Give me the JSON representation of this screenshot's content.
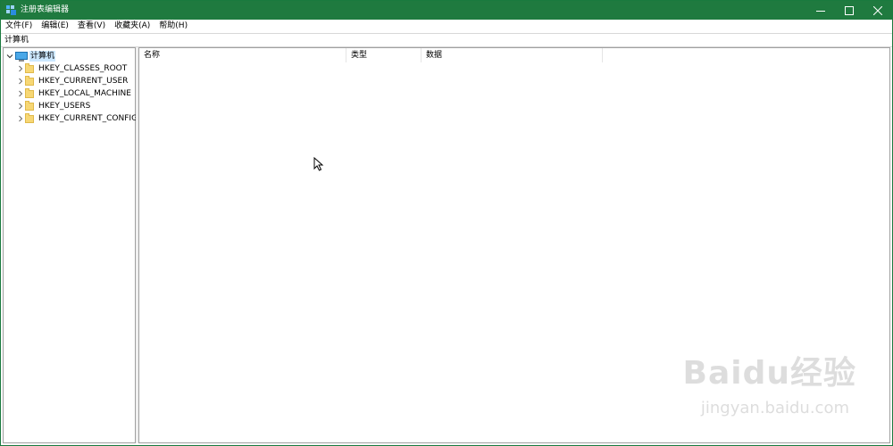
{
  "window": {
    "title": "注册表编辑器",
    "accent_color": "#1f7a3f"
  },
  "menu": [
    {
      "label": "文件(F)"
    },
    {
      "label": "编辑(E)"
    },
    {
      "label": "查看(V)"
    },
    {
      "label": "收藏夹(A)"
    },
    {
      "label": "帮助(H)"
    }
  ],
  "address": {
    "path": "计算机"
  },
  "tree": {
    "root": {
      "label": "计算机",
      "icon": "computer-icon",
      "expanded": true,
      "selected": true
    },
    "children": [
      {
        "label": "HKEY_CLASSES_ROOT",
        "icon": "folder-icon"
      },
      {
        "label": "HKEY_CURRENT_USER",
        "icon": "folder-icon"
      },
      {
        "label": "HKEY_LOCAL_MACHINE",
        "icon": "folder-icon"
      },
      {
        "label": "HKEY_USERS",
        "icon": "folder-icon"
      },
      {
        "label": "HKEY_CURRENT_CONFIG",
        "icon": "folder-icon"
      }
    ]
  },
  "list": {
    "columns": [
      {
        "label": "名称"
      },
      {
        "label": "类型"
      },
      {
        "label": "数据"
      }
    ]
  },
  "watermark": {
    "brand": "Baidu经验",
    "url": "jingyan.baidu.com"
  }
}
